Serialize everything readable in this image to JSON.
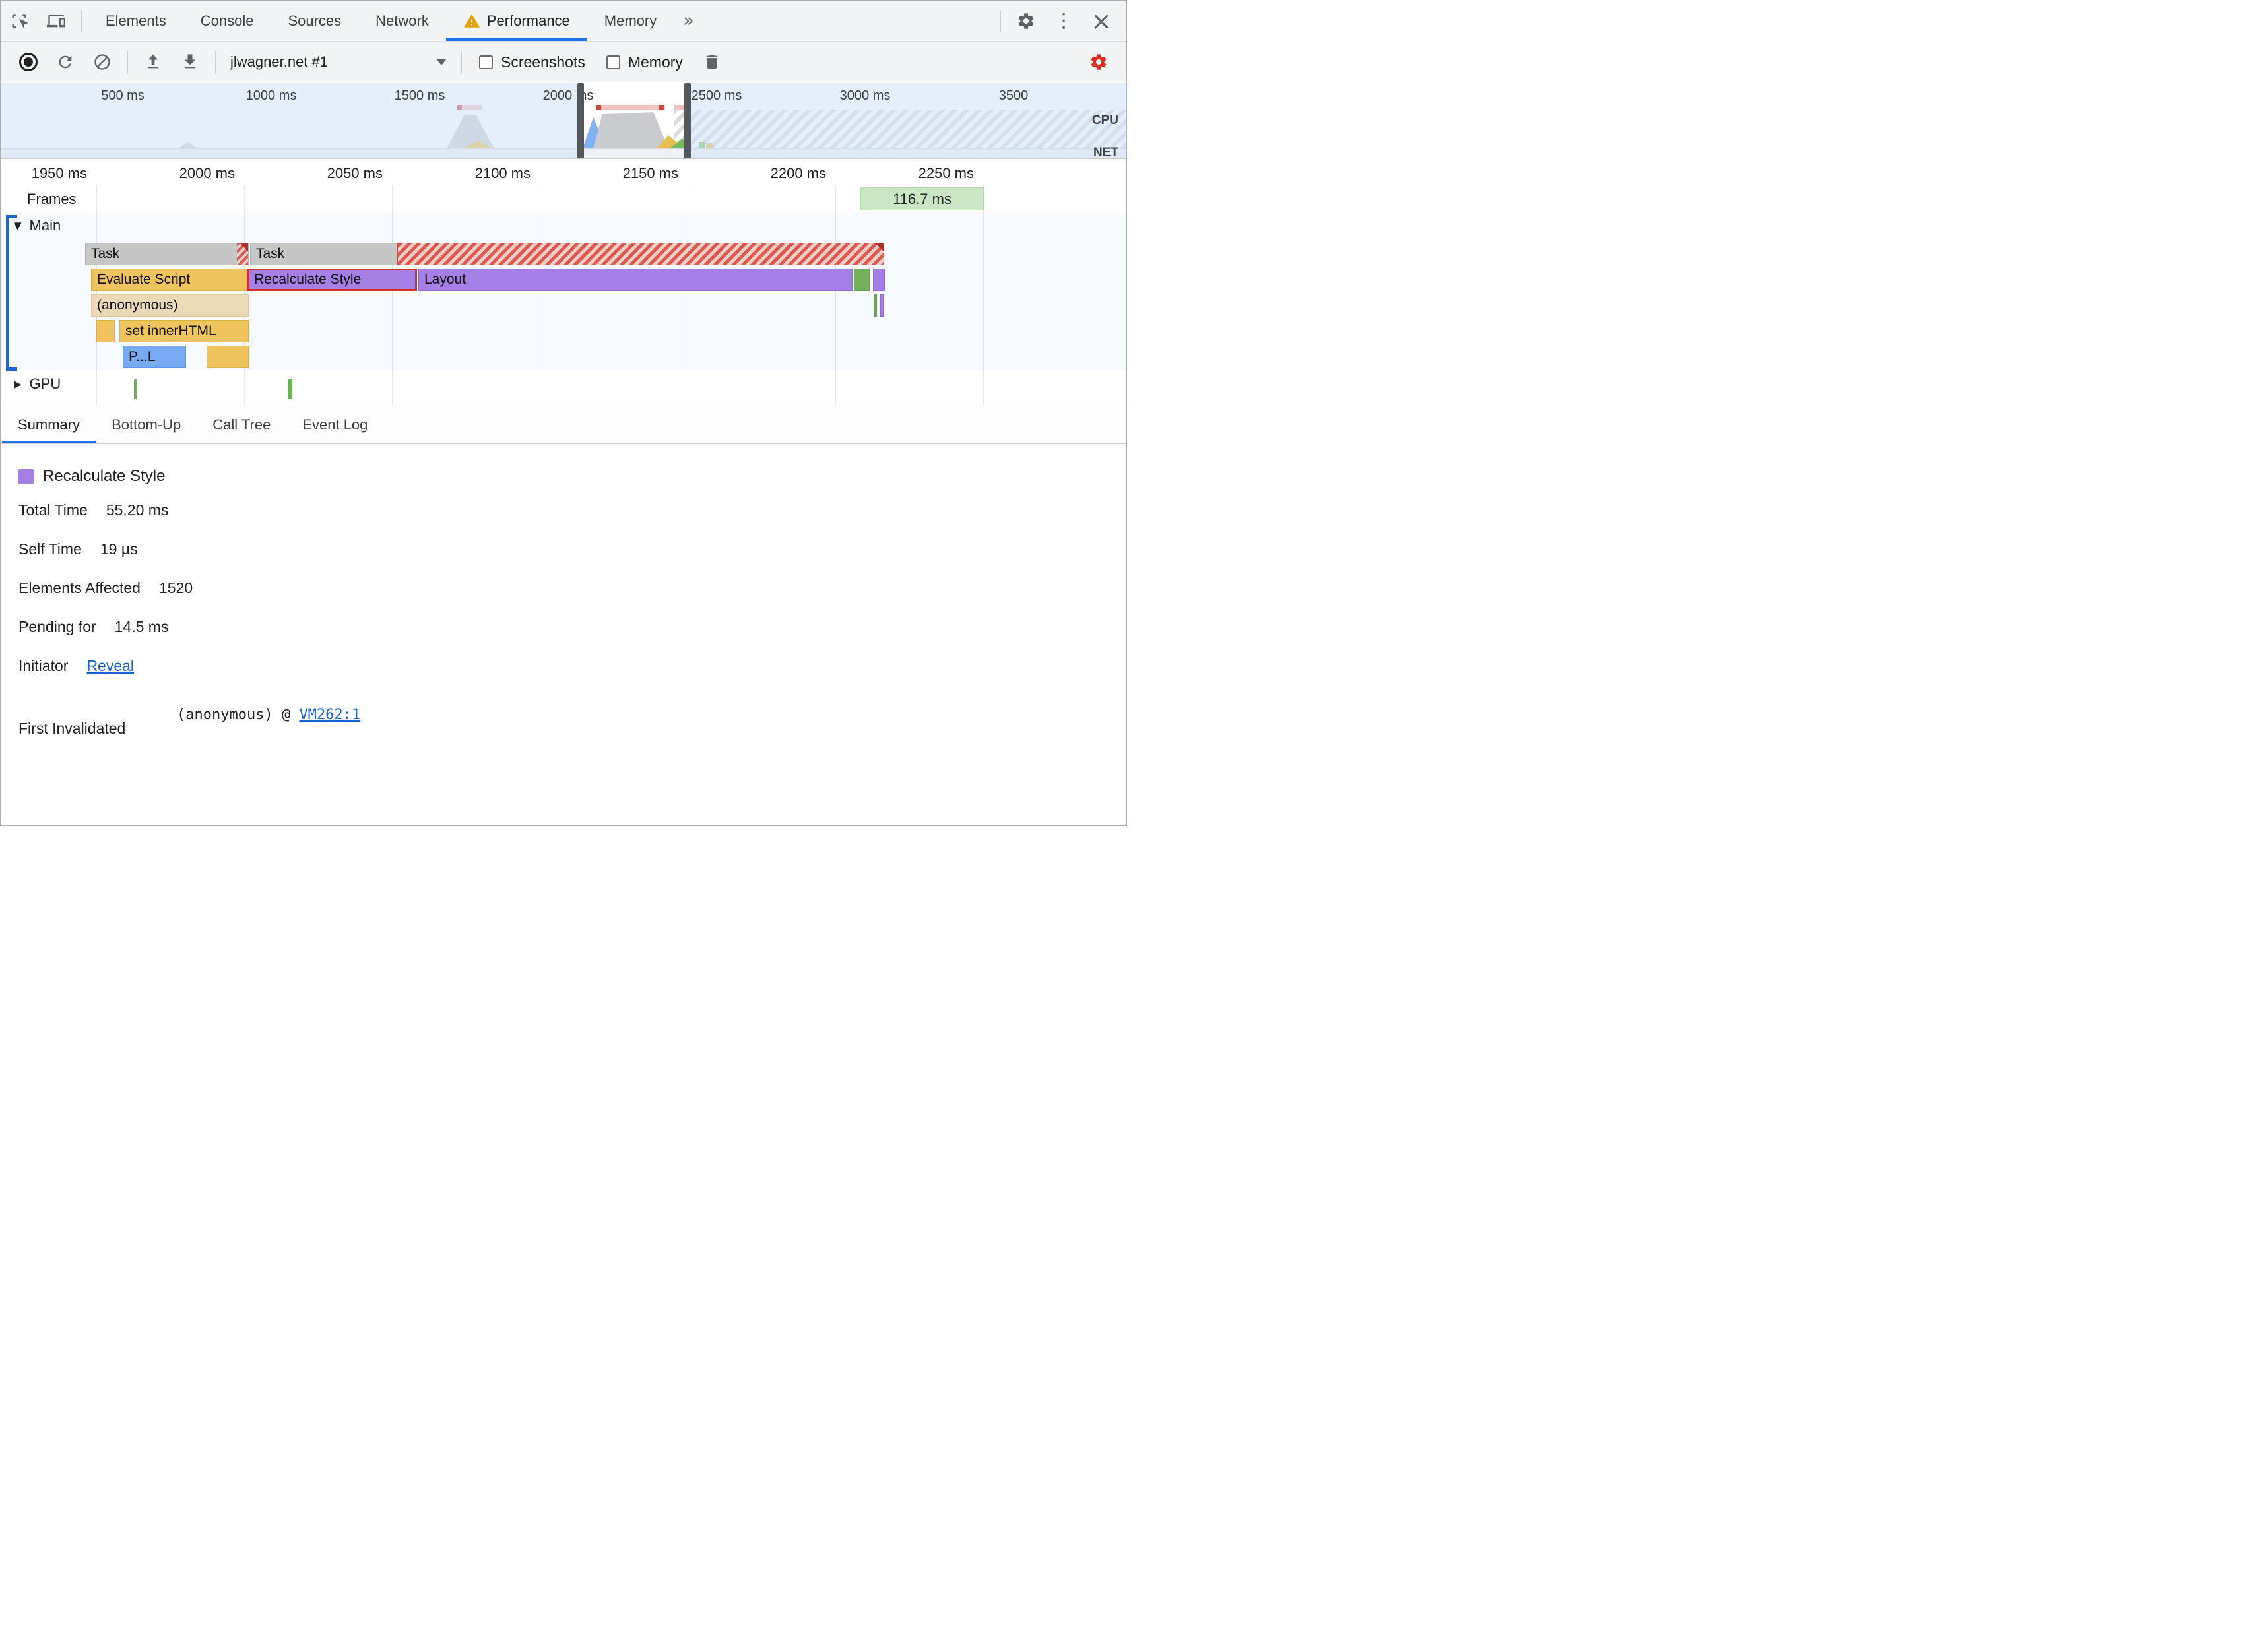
{
  "colors": {
    "accent_blue": "#1a73e8",
    "warning_orange": "#e8a303",
    "settings_alert_red": "#d93025",
    "task_gray": "#c6c6c6",
    "script_yellow": "#f0c45c",
    "style_purple": "#a57ee6",
    "function_tan": "#ecd9b8",
    "parse_blue": "#79a9f2",
    "paint_green": "#72b05c",
    "frame_chip_green": "#c9e7c3",
    "long_task_red": "#df5850",
    "link_blue": "#1961d2"
  },
  "icons": {
    "more_tabs": "»",
    "overflow_menu": "⋮",
    "close": "×"
  },
  "main_tabs": [
    {
      "label": "Elements"
    },
    {
      "label": "Console"
    },
    {
      "label": "Sources"
    },
    {
      "label": "Network"
    },
    {
      "label": "Performance"
    },
    {
      "label": "Memory"
    }
  ],
  "toolbar": {
    "profile_select": "jlwagner.net #1",
    "screenshots_label": "Screenshots",
    "memory_label": "Memory"
  },
  "overview": {
    "ticks": [
      "500 ms",
      "1000 ms",
      "1500 ms",
      "2000 ms",
      "2500 ms",
      "3000 ms",
      "3500"
    ],
    "cpu_label": "CPU",
    "net_label": "NET"
  },
  "timeline": {
    "ticks": [
      "1950 ms",
      "2000 ms",
      "2050 ms",
      "2100 ms",
      "2150 ms",
      "2200 ms",
      "2250 ms"
    ],
    "frames_label": "Frames",
    "frame_badge": "116.7 ms",
    "main_caret": "▼",
    "gpu_caret": "▶",
    "main_label": "Main",
    "gpu_label": "GPU",
    "bars": {
      "task1": "Task",
      "task2": "Task",
      "evaluate_script": "Evaluate Script",
      "recalculate_style": "Recalculate Style",
      "layout": "Layout",
      "anonymous": "(anonymous)",
      "set_inner_html": "set innerHTML",
      "parse_html": "P...L"
    }
  },
  "detail_tabs": [
    {
      "label": "Summary"
    },
    {
      "label": "Bottom-Up"
    },
    {
      "label": "Call Tree"
    },
    {
      "label": "Event Log"
    }
  ],
  "summary": {
    "title": "Recalculate Style",
    "rows": [
      {
        "label": "Total Time",
        "value": "55.20 ms"
      },
      {
        "label": "Self Time",
        "value": "19 µs"
      },
      {
        "label": "Elements Affected",
        "value": "1520"
      },
      {
        "label": "Pending for",
        "value": "14.5 ms"
      }
    ],
    "initiator_label": "Initiator",
    "initiator_link": "Reveal",
    "first_invalidated_label": "First Invalidated",
    "stack_fn": "(anonymous) @",
    "stack_link": "VM262:1"
  }
}
